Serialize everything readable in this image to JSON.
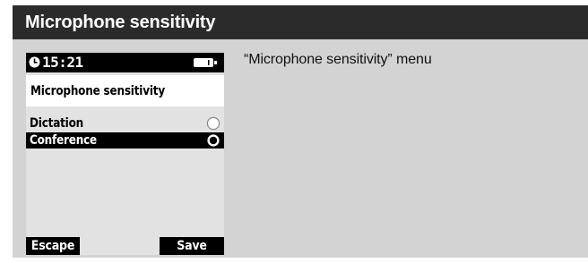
{
  "header": {
    "title": "Microphone sensitivity"
  },
  "device": {
    "status": {
      "time": "15:21",
      "clock_icon": "clock-icon",
      "battery_icon": "battery-icon"
    },
    "menu_title": "Microphone sensitivity",
    "options": [
      {
        "label": "Dictation",
        "selected": false
      },
      {
        "label": "Conference",
        "selected": true
      }
    ],
    "softkeys": {
      "left": "Escape",
      "right": "Save"
    }
  },
  "caption": "“Microphone sensitivity” menu",
  "colors": {
    "header_bg": "#2b2b2b",
    "panel_bg": "#d3d3d3",
    "screen_bg": "#e2e2e2",
    "lcd_black": "#000000"
  }
}
